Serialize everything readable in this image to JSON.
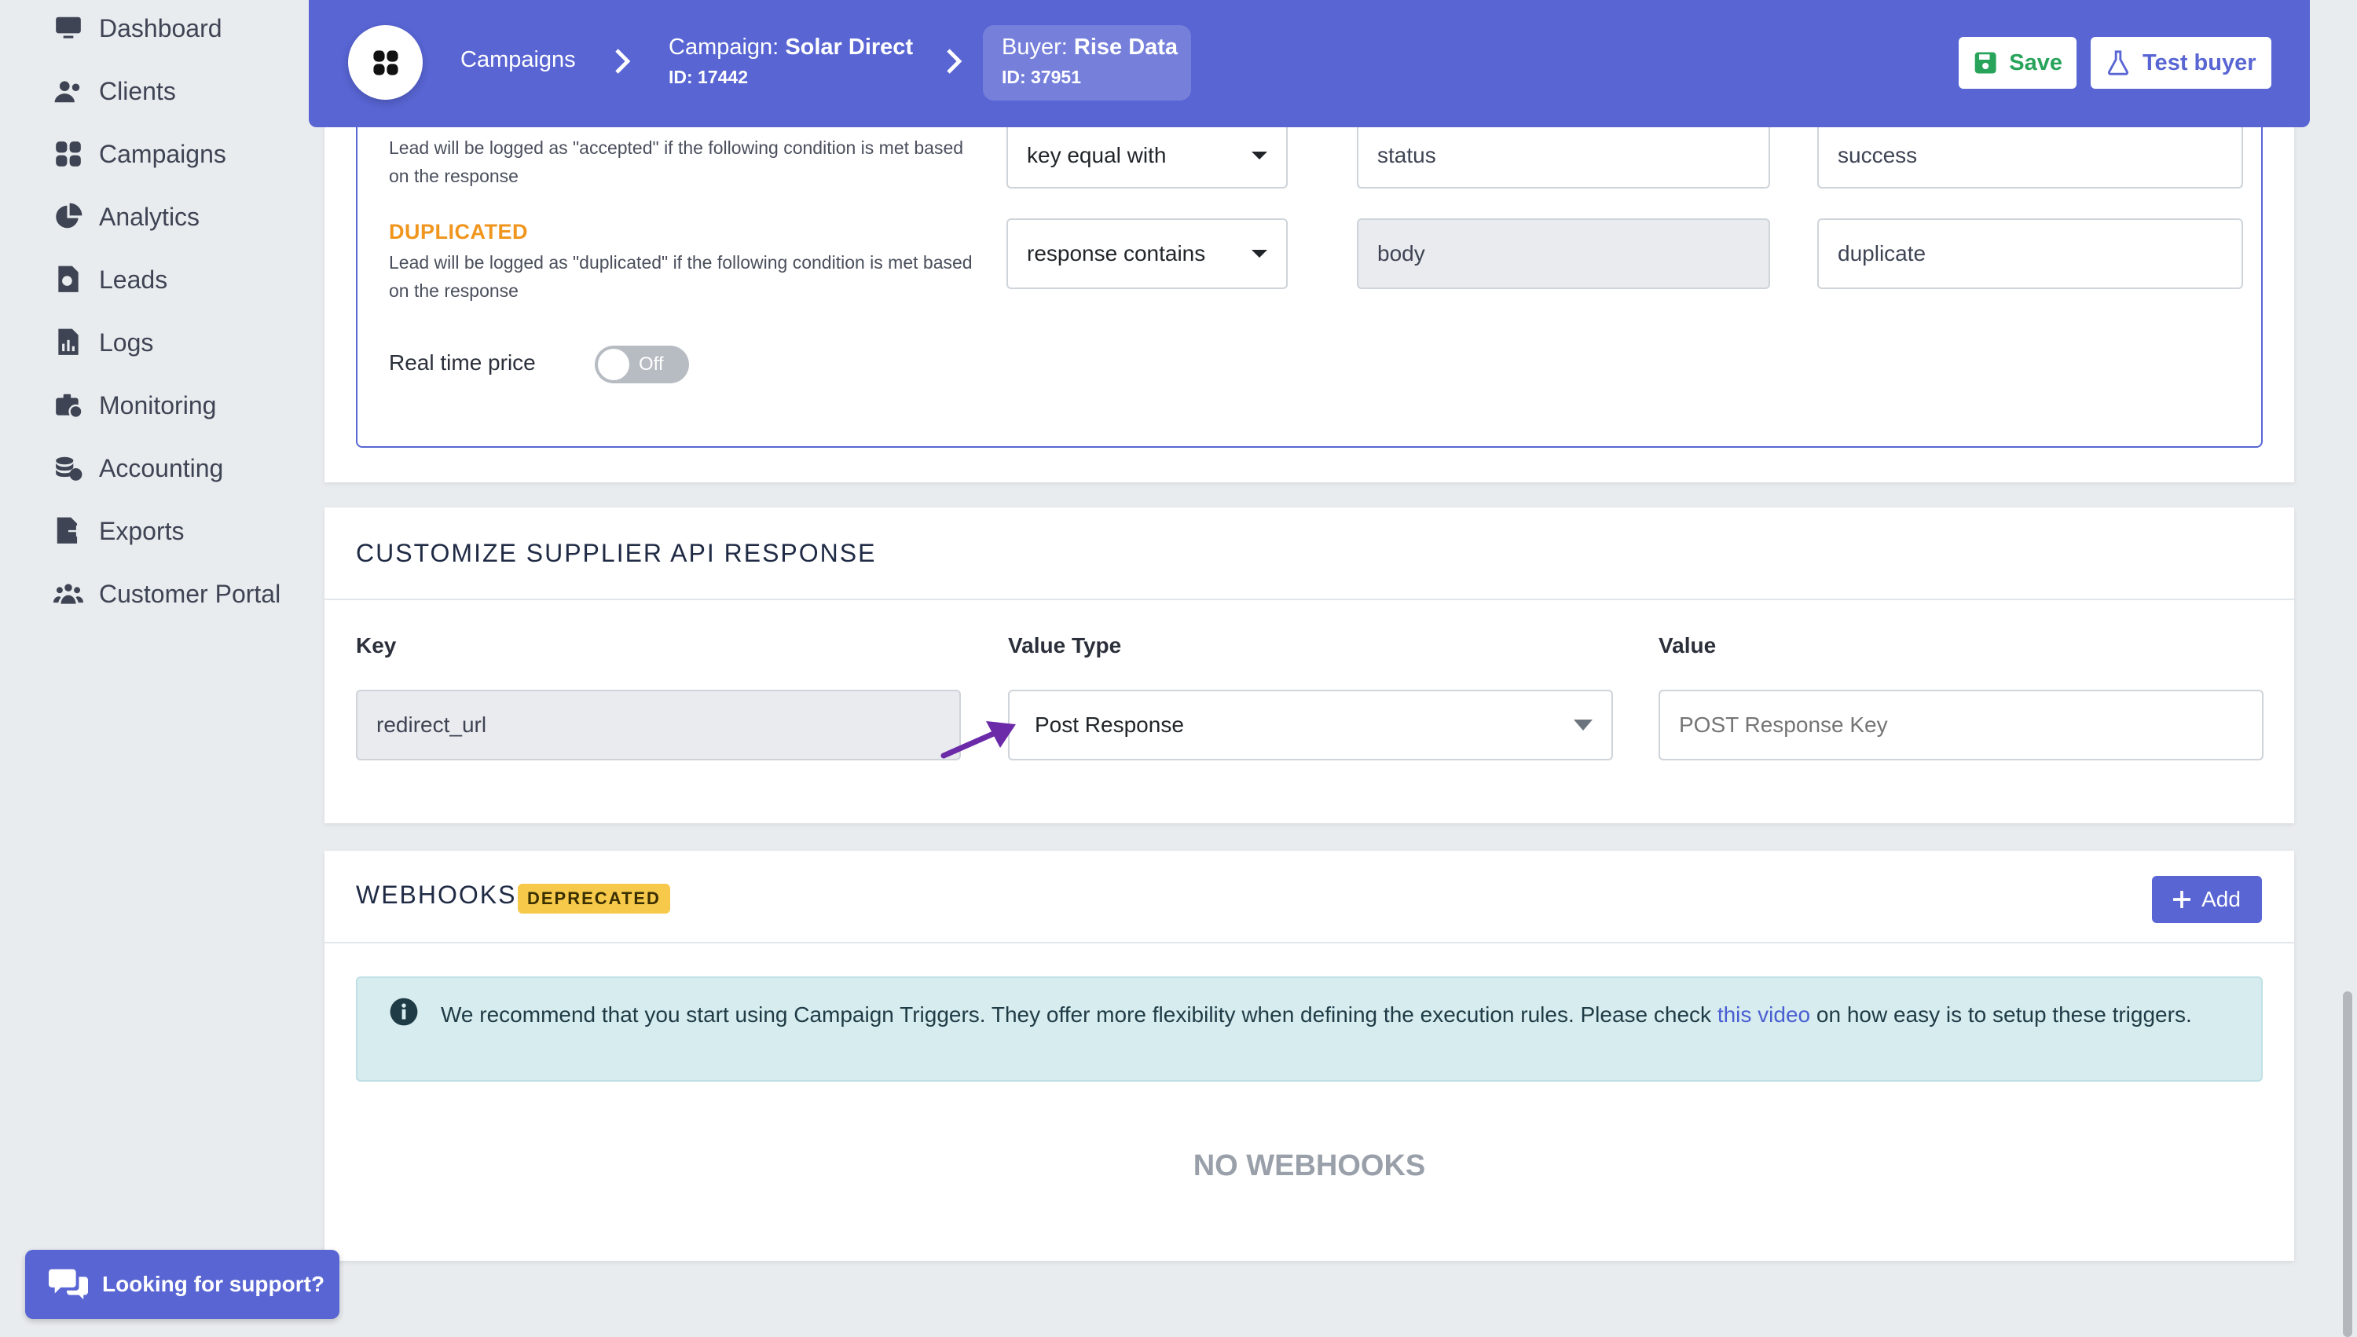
{
  "sidebar": {
    "items": [
      {
        "label": "Dashboard",
        "icon": "monitor-icon"
      },
      {
        "label": "Clients",
        "icon": "users-icon"
      },
      {
        "label": "Campaigns",
        "icon": "grid-icon"
      },
      {
        "label": "Analytics",
        "icon": "pie-chart-icon"
      },
      {
        "label": "Leads",
        "icon": "search-document-icon"
      },
      {
        "label": "Logs",
        "icon": "chart-document-icon"
      },
      {
        "label": "Monitoring",
        "icon": "briefcase-clock-icon"
      },
      {
        "label": "Accounting",
        "icon": "coins-icon"
      },
      {
        "label": "Exports",
        "icon": "file-export-icon"
      },
      {
        "label": "Customer Portal",
        "icon": "people-group-icon"
      }
    ]
  },
  "topbar": {
    "breadcrumb_campaigns": "Campaigns",
    "campaign_prefix": "Campaign: ",
    "campaign_name": "Solar Direct",
    "campaign_id": "ID: 17442",
    "buyer_prefix": "Buyer: ",
    "buyer_name": "Rise Data",
    "buyer_id": "ID: 37951",
    "save_label": "Save",
    "test_label": "Test buyer"
  },
  "response_rules": {
    "accepted_desc": "Lead will be logged as \"accepted\" if the following condition is met based on the response",
    "accepted_operator": "key equal with",
    "accepted_key": "status",
    "accepted_value": "success",
    "duplicated_label": "DUPLICATED",
    "duplicated_desc": "Lead will be logged as \"duplicated\" if the following condition is met based on the response",
    "duplicated_operator": "response contains",
    "duplicated_key": "body",
    "duplicated_value": "duplicate",
    "realtime_label": "Real time price",
    "realtime_state": "Off"
  },
  "supplier_api": {
    "title": "CUSTOMIZE SUPPLIER API RESPONSE",
    "key_header": "Key",
    "value_type_header": "Value Type",
    "value_header": "Value",
    "key_value": "redirect_url",
    "value_type": "Post Response",
    "value_placeholder": "POST Response Key"
  },
  "webhooks": {
    "title": "WEBHOOKS",
    "badge": "DEPRECATED",
    "add_label": "Add",
    "alert_text_1": "We recommend that you start using Campaign Triggers. They offer more flexibility when defining the execution rules. Please check ",
    "alert_link": "this video",
    "alert_text_2": " on how easy is to setup these triggers.",
    "empty": "NO WEBHOOKS"
  },
  "support": {
    "label": "Looking for support?"
  },
  "colors": {
    "accent": "#5865d3",
    "duplicated": "#f0961e",
    "save_icon": "#27a35a",
    "annotation_arrow": "#6b2aa8"
  }
}
